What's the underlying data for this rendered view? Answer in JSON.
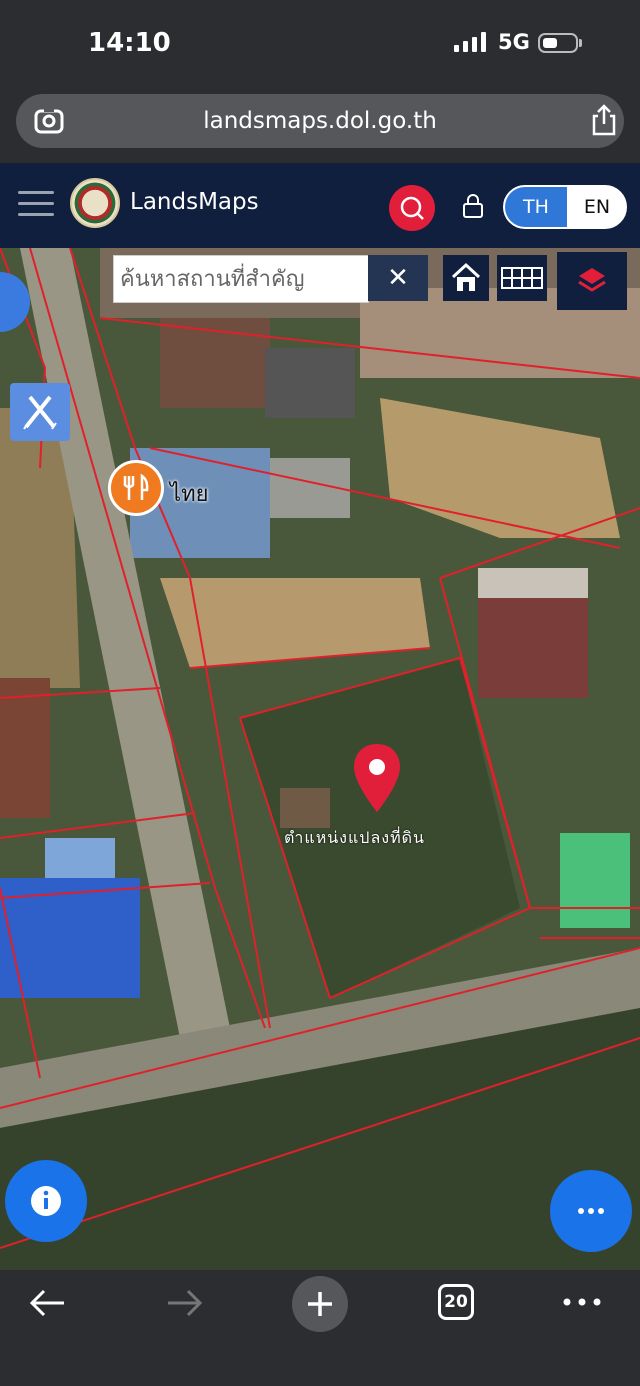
{
  "status_bar": {
    "time": "14:10",
    "network": "5G"
  },
  "browser": {
    "url": "landsmaps.dol.go.th",
    "tab_count": "20"
  },
  "app_header": {
    "brand": "LandsMaps",
    "lang_th": "TH",
    "lang_en": "EN"
  },
  "map": {
    "search_placeholder": "ค้นหาสถานที่สำคัญ",
    "clear_label": "✕",
    "poi_label": "ไทย",
    "parcel_label": "ตำแหน่งแปลงที่ดิน"
  },
  "colors": {
    "header_bg": "#0f1f3d",
    "accent_red": "#e21f3b",
    "fab_blue": "#1a73e8",
    "parcel_line": "#e0202a"
  },
  "icons": [
    "lens-icon",
    "share-icon",
    "hamburger-icon",
    "search-icon",
    "lock-icon",
    "home-icon",
    "grid-icon",
    "layers-icon",
    "draw-icon",
    "restaurant-icon",
    "location-pin-icon",
    "info-icon",
    "more-icon",
    "back-icon",
    "forward-icon",
    "plus-icon",
    "tabs-icon"
  ]
}
